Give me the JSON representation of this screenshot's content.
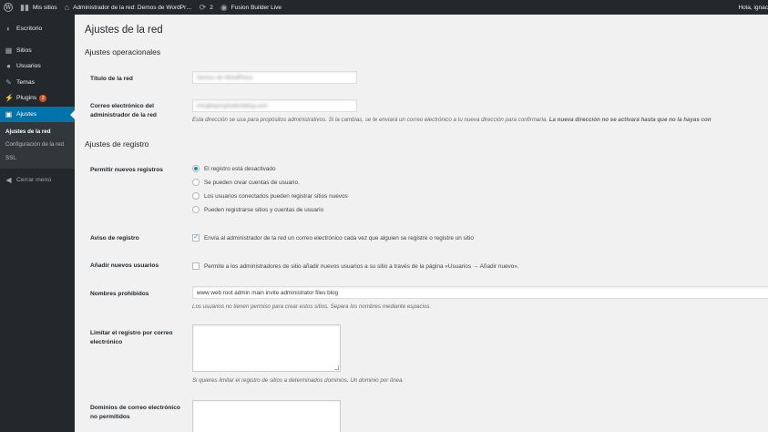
{
  "adminbar": {
    "wp_logo": "W",
    "my_sites": "Mis sitios",
    "site_name": "Administrador de la red: Demos de WordPr…",
    "updates_count": "2",
    "fusion": "Fusion Builder Live",
    "howdy": "Hola, ignac"
  },
  "sidebar": {
    "items": [
      {
        "label": "Escritorio",
        "icon": "dashboard-icon",
        "glyph": "◐"
      },
      {
        "label": "Sitios",
        "icon": "sites-icon",
        "glyph": "▦"
      },
      {
        "label": "Usuarios",
        "icon": "users-icon",
        "glyph": "●"
      },
      {
        "label": "Temas",
        "icon": "themes-icon",
        "glyph": "✎"
      },
      {
        "label": "Plugins",
        "icon": "plugins-icon",
        "glyph": "⚡",
        "badge": "2"
      },
      {
        "label": "Ajustes",
        "icon": "settings-icon",
        "glyph": "▣"
      }
    ],
    "submenu": [
      "Ajustes de la red",
      "Configuración de la red",
      "SSL"
    ],
    "collapse": "Cerrar menú"
  },
  "page": {
    "title": "Ajustes de la red",
    "operational_title": "Ajustes operacionales",
    "network_title_label": "Título de la red",
    "network_title_value": "Demos de WordPress",
    "admin_email_label_1": "Correo electrónico del",
    "admin_email_label_2": "administrador de la red",
    "admin_email_value": "info@ejemplodemiblog.com",
    "admin_email_desc": "Esta dirección se usa para propósitos administrativos. Si la cambias, se te enviará un correo electrónico a tu nueva dirección para confirmarla. ",
    "admin_email_desc_bold": "La nueva dirección no se activará hasta que no la hayas con",
    "registration_title": "Ajustes de registro",
    "allow_reg_label": "Permitir nuevos registros",
    "reg_options": [
      "El registro está desactivado",
      "Se pueden crear cuentas de usuario.",
      "Los usuarios conectados pueden registrar sitios nuevos",
      "Pueden registrarse sitios y cuentas de usuario"
    ],
    "reg_notice_label": "Aviso de registro",
    "reg_notice_text": "Envía al administrador de la red un correo electrónico cada vez que alguien se registre o registre un sitio",
    "add_users_label": "Añadir nuevos usuarios",
    "add_users_text": "Permite a los administradores de sitio añadir nuevos usuarios a su sitio a través de la página «Usuarios → Añadir nuevo».",
    "banned_names_label": "Nombres prohibidos",
    "banned_names_value": "www web root admin main invite administrator files blog",
    "banned_names_desc": "Los usuarios no tienen permiso para crear estos sitios. Separa los nombres mediante espacios.",
    "limited_email_label_1": "Limitar el registro por correo",
    "limited_email_label_2": "electrónico",
    "limited_email_desc": "Si quieres limitar el registro de sitios a determinados dominios. Un dominio por línea.",
    "banned_email_label_1": "Dominios de correo electrónico",
    "banned_email_label_2": "no permitidos"
  }
}
